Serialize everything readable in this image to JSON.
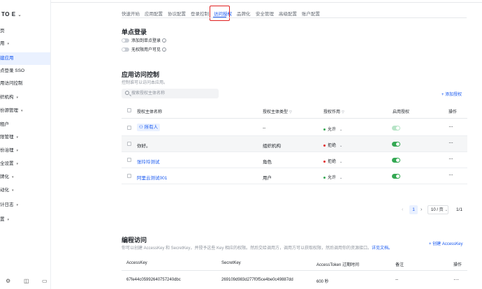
{
  "sidebar": {
    "brand": "TO E",
    "items": [
      {
        "label": "页",
        "chev": false
      },
      {
        "label": "用",
        "chev": true
      },
      {
        "label": "建应用",
        "chev": false,
        "active": true
      },
      {
        "label": "点登录 SSO",
        "chev": false
      },
      {
        "label": "用访问控制",
        "chev": false
      },
      {
        "label": "织机构",
        "chev": true
      },
      {
        "label": "份源管理",
        "chev": true
      },
      {
        "label": "租户",
        "chev": false
      },
      {
        "label": "限管理",
        "chev": true
      },
      {
        "label": "份治理",
        "chev": true
      },
      {
        "label": "全设置",
        "chev": true
      },
      {
        "label": "牌化",
        "chev": true
      },
      {
        "label": "动化",
        "chev": true
      },
      {
        "label": "计日志",
        "chev": true
      },
      {
        "label": "置",
        "chev": true
      }
    ]
  },
  "tabs": [
    "快速开始",
    "应用配置",
    "协议配置",
    "登录控制",
    "访问授权",
    "品牌化",
    "安全管理",
    "高级配置",
    "账户配置"
  ],
  "active_tab": "访问授权",
  "sso": {
    "title": "单点登录",
    "toggles": [
      {
        "label": "添加到单点登录"
      },
      {
        "label": "无权限用户可见"
      }
    ]
  },
  "access": {
    "title": "应用访问控制",
    "subtitle": "控制谁可以访问本应用。",
    "search_placeholder": "搜索授权主体名称",
    "add_label": "+ 添加授权",
    "columns": {
      "name": "授权主体名称",
      "type": "授权主体类型",
      "effect": "授权作用",
      "enabled": "启用授权",
      "ops": "操作"
    },
    "rows": [
      {
        "name": "所有人",
        "type": "--",
        "effect": "允许",
        "effect_color": "#34a853",
        "style": "tag",
        "enabled_faded": true
      },
      {
        "name": "你好。",
        "type": "组织机构",
        "effect": "拒绝",
        "effect_color": "#e02020",
        "style": "plain",
        "enabled_faded": false
      },
      {
        "name": "张玲玲测试",
        "type": "角色",
        "effect": "拒绝",
        "effect_color": "#e02020",
        "style": "link",
        "enabled_faded": false
      },
      {
        "name": "阿里云测试001",
        "type": "用户",
        "effect": "允许",
        "effect_color": "#34a853",
        "style": "link",
        "enabled_faded": false
      }
    ],
    "more_label": "···",
    "pagination": {
      "prev": "‹",
      "page": "1",
      "next": "›",
      "page_size": "10 / 页",
      "total": "1/1"
    }
  },
  "programmatic": {
    "title": "编程访问",
    "desc": "你可以创建 AccessKey 和 SecretKey，并授予这些 Key 相应的权限。然后交给调用方，调用方可以获取权限，然后调用你的资源接口。",
    "desc_link": "详见文档。",
    "create_label": "+ 创建 AccessKey",
    "columns": {
      "access_key": "AccessKey",
      "secret_key": "SecretKey",
      "token_expiry": "AccessToken 过期时间",
      "note": "备注",
      "ops": "操作"
    },
    "row": {
      "access_key": "67fe44c05992640757240dbc",
      "secret_key": "269109d983d277f0f5ce4be0c49887dd",
      "token_expiry": "600 秒",
      "note": "--",
      "ops": "···"
    }
  }
}
